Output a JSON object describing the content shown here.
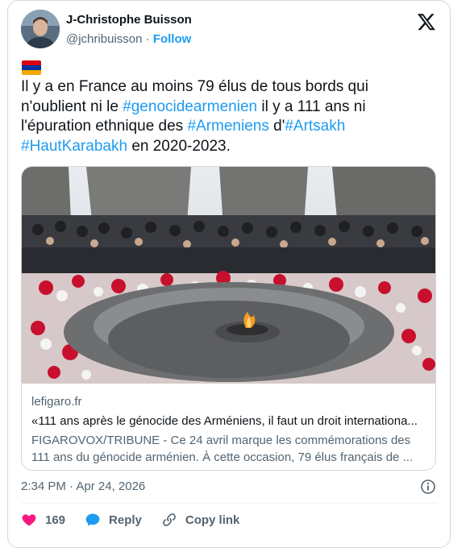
{
  "author": {
    "name": "J-Christophe Buisson",
    "handle": "@jchribuisson",
    "separator": " · ",
    "follow_label": "Follow"
  },
  "tweet": {
    "flag_colors": [
      "#d90012",
      "#0033a0",
      "#f2a800"
    ],
    "segments": [
      {
        "text": "Il y a en France au moins 79 élus de tous bords qui n'oublient ni le ",
        "tag": false
      },
      {
        "text": "#genocidearmenien",
        "tag": true
      },
      {
        "text": " il y a 111 ans ni l'épuration ethnique des ",
        "tag": false
      },
      {
        "text": "#Armeniens",
        "tag": true
      },
      {
        "text": " d'",
        "tag": false
      },
      {
        "text": "#Artsakh",
        "tag": true
      },
      {
        "text": " ",
        "tag": false
      },
      {
        "text": "#HautKarabakh",
        "tag": true
      },
      {
        "text": " en 2020-2023.",
        "tag": false
      }
    ]
  },
  "link_card": {
    "domain": "lefigaro.fr",
    "title": "«111 ans après le génocide des Arméniens, il faut un droit internationa...",
    "description": "FIGAROVOX/TRIBUNE - Ce 24 avril marque les commémorations des 111 ans du génocide arménien. À cette occasion, 79 élus français de ..."
  },
  "meta": {
    "timestamp": "2:34 PM · Apr 24, 2026"
  },
  "actions": {
    "like_count": "169",
    "reply_label": "Reply",
    "copy_label": "Copy link"
  },
  "colors": {
    "link": "#1d9bf0",
    "like": "#f91880",
    "text": "#0f1419",
    "secondary": "#536471"
  }
}
